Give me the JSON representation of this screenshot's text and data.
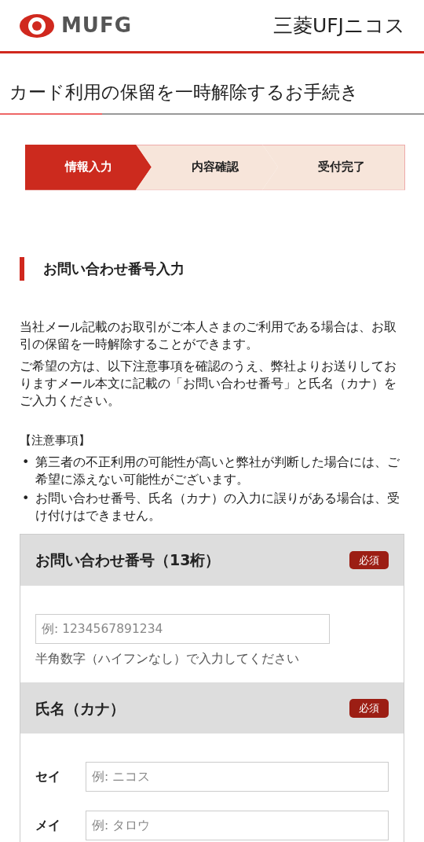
{
  "header": {
    "logo_text": "MUFG",
    "brand": "三菱UFJニコス"
  },
  "page_title": "カード利用の保留を一時解除するお手続き",
  "steps": [
    {
      "label": "情報入力",
      "selected": true
    },
    {
      "label": "内容確認",
      "selected": false
    },
    {
      "label": "受付完了",
      "selected": false
    }
  ],
  "section_title": "お問い合わせ番号入力",
  "intro": [
    "当社メール記載のお取引がご本人さまのご利用である場合は、お取引の保留を一時解除することができます。",
    "ご希望の方は、以下注意事項を確認のうえ、弊社よりお送りしておりますメール本文に記載の「お問い合わせ番号」と氏名（カナ）をご入力ください。"
  ],
  "notes_title": "【注意事項】",
  "notes": [
    {
      "marker": "•",
      "text": "第三者の不正利用の可能性が高いと弊社が判断した場合には、ご希望に添えない可能性がございます。"
    },
    {
      "marker": "•",
      "text": "お問い合わせ番号、氏名（カナ）の入力に誤りがある場合は、受け付けはできません。"
    }
  ],
  "form": [
    {
      "label": "お問い合わせ番号（13桁）",
      "badge": "必須",
      "kind": "single",
      "placeholder": "例: 1234567891234",
      "hint": "半角数字（ハイフンなし）で入力してください"
    },
    {
      "label": "氏名（カナ）",
      "badge": "必須",
      "kind": "pair",
      "fields": [
        {
          "label": "セイ",
          "placeholder": "例: ニコス"
        },
        {
          "label": "メイ",
          "placeholder": "例: タロウ"
        }
      ]
    }
  ]
}
